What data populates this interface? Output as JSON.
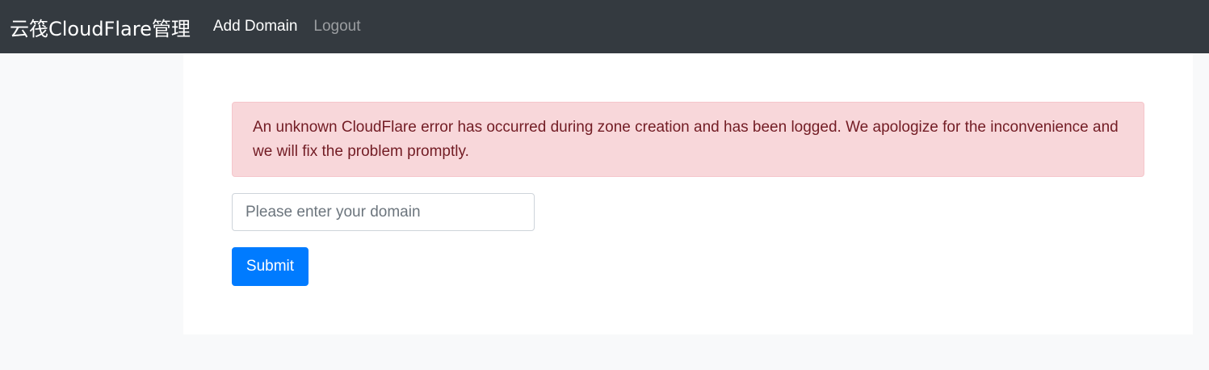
{
  "navbar": {
    "brand": "云筏CloudFlare管理",
    "links": [
      {
        "label": "Add Domain",
        "active": true
      },
      {
        "label": "Logout",
        "active": false
      }
    ]
  },
  "alert": {
    "message": "An unknown CloudFlare error has occurred during zone creation and has been logged. We apologize for the inconvenience and we will fix the problem promptly."
  },
  "form": {
    "domain_placeholder": "Please enter your domain",
    "domain_value": "",
    "submit_label": "Submit"
  },
  "colors": {
    "navbar_bg": "#343a40",
    "alert_bg": "#f8d7da",
    "alert_text": "#721c24",
    "primary": "#007bff",
    "page_bg": "#f8f9fa"
  }
}
